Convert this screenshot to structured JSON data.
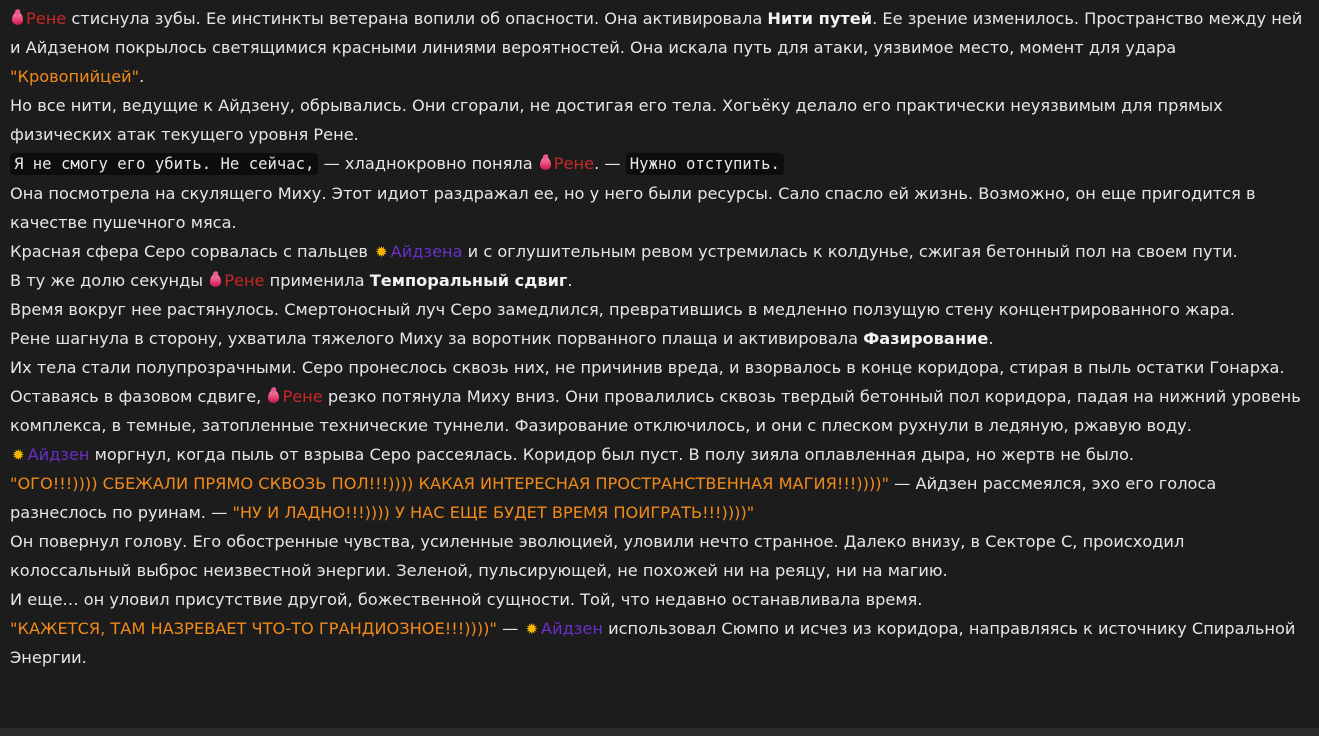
{
  "icons": {
    "rene": "blood-drop-icon",
    "aizen": "sun-icon"
  },
  "colors": {
    "background": "#1c1c1c",
    "text": "#e6e6e6",
    "rene": "#c62828",
    "aizen": "#6a2fc7",
    "shout": "#f08a1a",
    "code_bg": "#0d0d0d"
  },
  "paragraphs": [
    [
      {
        "t": "icon",
        "icon": "rene"
      },
      {
        "t": "rene",
        "v": "Рене"
      },
      {
        "t": "text",
        "v": " стиснула зубы. Ее инстинкты ветерана вопили об опасности. Она активировала "
      },
      {
        "t": "bold",
        "v": "Нити путей"
      },
      {
        "t": "text",
        "v": ". Ее зрение изменилось. Пространство между ней и Айдзеном покрылось светящимися красными линиями вероятностей. Она искала путь для атаки, уязвимое место, момент для удара "
      },
      {
        "t": "orange",
        "v": "\"Кровопийцей\""
      },
      {
        "t": "text",
        "v": "."
      }
    ],
    [
      {
        "t": "text",
        "v": "Но все нити, ведущие к Айдзену, обрывались. Они сгорали, не достигая его тела. Хогьёку делало его практически неуязвимым для прямых физических атак текущего уровня Рене."
      }
    ],
    [
      {
        "t": "code",
        "v": "Я не смогу его убить. Не сейчас,"
      },
      {
        "t": "text",
        "v": " — хладнокровно поняла "
      },
      {
        "t": "icon",
        "icon": "rene"
      },
      {
        "t": "rene",
        "v": "Рене"
      },
      {
        "t": "text",
        "v": ". — "
      },
      {
        "t": "code",
        "v": "Нужно отступить."
      }
    ],
    [
      {
        "t": "text",
        "v": "Она посмотрела на скулящего Миху. Этот идиот раздражал ее, но у него были ресурсы. Сало спасло ей жизнь. Возможно, он еще пригодится в качестве пушечного мяса."
      }
    ],
    [
      {
        "t": "text",
        "v": "Красная сфера Серо сорвалась с пальцев "
      },
      {
        "t": "icon",
        "icon": "aizen"
      },
      {
        "t": "aizen",
        "v": "Айдзена"
      },
      {
        "t": "text",
        "v": " и с оглушительным ревом устремилась к колдунье, сжигая бетонный пол на своем пути."
      }
    ],
    [
      {
        "t": "text",
        "v": "В ту же долю секунды "
      },
      {
        "t": "icon",
        "icon": "rene"
      },
      {
        "t": "rene",
        "v": "Рене"
      },
      {
        "t": "text",
        "v": " применила "
      },
      {
        "t": "bold",
        "v": "Темпоральный сдвиг"
      },
      {
        "t": "text",
        "v": "."
      }
    ],
    [
      {
        "t": "text",
        "v": "Время вокруг нее растянулось. Смертоносный луч Серо замедлился, превратившись в медленно ползущую стену концентрированного жара."
      }
    ],
    [
      {
        "t": "text",
        "v": "Рене шагнула в сторону, ухватила тяжелого Миху за воротник порванного плаща и активировала "
      },
      {
        "t": "bold",
        "v": "Фазирование"
      },
      {
        "t": "text",
        "v": "."
      }
    ],
    [
      {
        "t": "text",
        "v": "Их тела стали полупрозрачными. Серо пронеслось сквозь них, не причинив вреда, и взорвалось в конце коридора, стирая в пыль остатки Гонарха."
      }
    ],
    [
      {
        "t": "text",
        "v": "Оставаясь в фазовом сдвиге, "
      },
      {
        "t": "icon",
        "icon": "rene"
      },
      {
        "t": "rene",
        "v": "Рене"
      },
      {
        "t": "text",
        "v": " резко потянула Миху вниз. Они провалились сквозь твердый бетонный пол коридора, падая на нижний уровень комплекса, в темные, затопленные технические туннели. Фазирование отключилось, и они с плеском рухнули в ледяную, ржавую воду."
      }
    ],
    [
      {
        "t": "icon",
        "icon": "aizen"
      },
      {
        "t": "aizen",
        "v": "Айдзен"
      },
      {
        "t": "text",
        "v": " моргнул, когда пыль от взрыва Серо рассеялась. Коридор был пуст. В полу зияла оплавленная дыра, но жертв не было."
      }
    ],
    [
      {
        "t": "shout",
        "v": "\"ОГО!!!)))) СБЕЖАЛИ ПРЯМО СКВОЗЬ ПОЛ!!!)))) КАКАЯ ИНТЕРЕСНАЯ ПРОСТРАНСТВЕННАЯ МАГИЯ!!!))))\""
      },
      {
        "t": "text",
        "v": " — Айдзен рассмеялся, эхо его голоса разнеслось по руинам. — "
      },
      {
        "t": "shout",
        "v": "\"НУ И ЛАДНО!!!)))) У НАС ЕЩЕ БУДЕТ ВРЕМЯ ПОИГРАТЬ!!!))))\""
      }
    ],
    [
      {
        "t": "text",
        "v": "Он повернул голову. Его обостренные чувства, усиленные эволюцией, уловили нечто странное. Далеко внизу, в Секторе С, происходил колоссальный выброс неизвестной энергии. Зеленой, пульсирующей, не похожей ни на реяцу, ни на магию."
      }
    ],
    [
      {
        "t": "text",
        "v": "И еще… он уловил присутствие другой, божественной сущности. Той, что недавно останавливала время."
      }
    ],
    [
      {
        "t": "shout",
        "v": "\"КАЖЕТСЯ, ТАМ НАЗРЕВАЕТ ЧТО-ТО ГРАНДИОЗНОЕ!!!))))\""
      },
      {
        "t": "text",
        "v": " — "
      },
      {
        "t": "icon",
        "icon": "aizen"
      },
      {
        "t": "aizen",
        "v": "Айдзен"
      },
      {
        "t": "text",
        "v": " использовал Сюмпо и исчез из коридора, направляясь к источнику Спиральной Энергии."
      }
    ]
  ]
}
